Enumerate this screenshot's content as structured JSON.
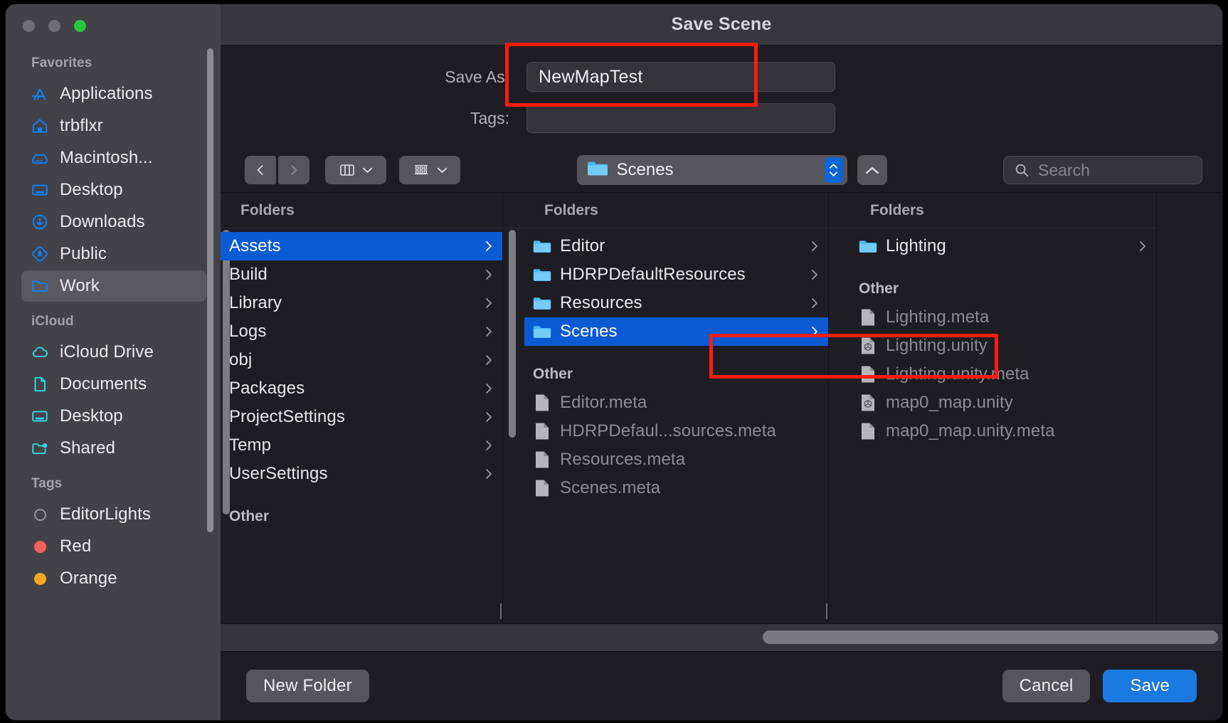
{
  "window": {
    "title": "Save Scene",
    "traffic_lights": [
      "close-button",
      "minimize-button",
      "zoom-button"
    ]
  },
  "colors": {
    "accent_blue": "#0a5ad4",
    "primary_button": "#1b7ae0",
    "annotation_red": "#ff1c0a",
    "sidebar_bg": "#434248",
    "panel_bg": "#1e1d24",
    "titlebar_bg": "#38373d"
  },
  "sidebar": {
    "sections": [
      {
        "title": "Favorites",
        "items": [
          {
            "label": "Applications",
            "icon": "applications-icon",
            "selected": false
          },
          {
            "label": "trbflxr",
            "icon": "home-icon",
            "selected": false
          },
          {
            "label": "Macintosh...",
            "icon": "harddisk-icon",
            "selected": false
          },
          {
            "label": "Desktop",
            "icon": "desktop-icon",
            "selected": false
          },
          {
            "label": "Downloads",
            "icon": "downloads-icon",
            "selected": false
          },
          {
            "label": "Public",
            "icon": "public-folder-icon",
            "selected": false
          },
          {
            "label": "Work",
            "icon": "folder-icon",
            "selected": true
          }
        ]
      },
      {
        "title": "iCloud",
        "items": [
          {
            "label": "iCloud Drive",
            "icon": "cloud-icon",
            "selected": false
          },
          {
            "label": "Documents",
            "icon": "document-icon",
            "selected": false
          },
          {
            "label": "Desktop",
            "icon": "desktop-icon",
            "selected": false
          },
          {
            "label": "Shared",
            "icon": "shared-folder-icon",
            "selected": false
          }
        ]
      },
      {
        "title": "Tags",
        "items": [
          {
            "label": "EditorLights",
            "icon": "tag-dot-hollow",
            "color": "",
            "selected": false
          },
          {
            "label": "Red",
            "icon": "tag-dot",
            "color": "#f4605c",
            "selected": false
          },
          {
            "label": "Orange",
            "icon": "tag-dot",
            "color": "#f5a623",
            "selected": false
          }
        ]
      }
    ]
  },
  "fields": {
    "save_as_label": "Save As:",
    "save_as_value": "NewMapTest",
    "tags_label": "Tags:",
    "tags_value": ""
  },
  "toolbar": {
    "back_icon": "chevron-left-icon",
    "forward_icon": "chevron-right-icon",
    "view_mode_icon": "column-view-icon",
    "group_by_icon": "group-items-icon",
    "path_label": "Scenes",
    "path_icon": "folder-icon",
    "stepper_icon": "up-down-stepper-icon",
    "up_icon": "chevron-up-icon",
    "search_placeholder": "Search",
    "search_icon": "search-icon",
    "search_value": ""
  },
  "browser": {
    "columns": [
      {
        "header": "Folders",
        "items": [
          {
            "label": "Assets",
            "type": "folder",
            "icon": "",
            "selected": true,
            "chevron": true,
            "disabled": false
          },
          {
            "label": "Build",
            "type": "folder",
            "icon": "",
            "selected": false,
            "chevron": true,
            "disabled": false
          },
          {
            "label": "Library",
            "type": "folder",
            "icon": "",
            "selected": false,
            "chevron": true,
            "disabled": false
          },
          {
            "label": "Logs",
            "type": "folder",
            "icon": "",
            "selected": false,
            "chevron": true,
            "disabled": false
          },
          {
            "label": "obj",
            "type": "folder",
            "icon": "",
            "selected": false,
            "chevron": true,
            "disabled": false
          },
          {
            "label": "Packages",
            "type": "folder",
            "icon": "",
            "selected": false,
            "chevron": true,
            "disabled": false
          },
          {
            "label": "ProjectSettings",
            "type": "folder",
            "icon": "",
            "selected": false,
            "chevron": true,
            "disabled": false
          },
          {
            "label": "Temp",
            "type": "folder",
            "icon": "",
            "selected": false,
            "chevron": true,
            "disabled": false
          },
          {
            "label": "UserSettings",
            "type": "folder",
            "icon": "",
            "selected": false,
            "chevron": true,
            "disabled": false
          }
        ],
        "sub_header": "Other",
        "sub_items": []
      },
      {
        "header": "Folders",
        "items": [
          {
            "label": "Editor",
            "type": "folder",
            "icon": "folder-icon",
            "selected": false,
            "chevron": true,
            "disabled": false
          },
          {
            "label": "HDRPDefaultResources",
            "type": "folder",
            "icon": "folder-icon",
            "selected": false,
            "chevron": true,
            "disabled": false
          },
          {
            "label": "Resources",
            "type": "folder",
            "icon": "folder-icon",
            "selected": false,
            "chevron": true,
            "disabled": false
          },
          {
            "label": "Scenes",
            "type": "folder",
            "icon": "folder-icon",
            "selected": true,
            "chevron": true,
            "disabled": false
          }
        ],
        "sub_header": "Other",
        "sub_items": [
          {
            "label": "Editor.meta",
            "type": "file",
            "icon": "file-icon",
            "disabled": true
          },
          {
            "label": "HDRPDefaul...sources.meta",
            "type": "file",
            "icon": "file-icon",
            "disabled": true
          },
          {
            "label": "Resources.meta",
            "type": "file",
            "icon": "file-icon",
            "disabled": true
          },
          {
            "label": "Scenes.meta",
            "type": "file",
            "icon": "file-icon",
            "disabled": true
          }
        ]
      },
      {
        "header": "Folders",
        "items": [
          {
            "label": "Lighting",
            "type": "folder",
            "icon": "folder-icon",
            "selected": false,
            "chevron": true,
            "disabled": false
          }
        ],
        "sub_header": "Other",
        "sub_items": [
          {
            "label": "Lighting.meta",
            "type": "file",
            "icon": "file-icon",
            "disabled": true
          },
          {
            "label": "Lighting.unity",
            "type": "file",
            "icon": "unity-file-icon",
            "disabled": true
          },
          {
            "label": "Lighting.unity.meta",
            "type": "file",
            "icon": "file-icon",
            "disabled": true
          },
          {
            "label": "map0_map.unity",
            "type": "file",
            "icon": "unity-file-icon",
            "disabled": true
          },
          {
            "label": "map0_map.unity.meta",
            "type": "file",
            "icon": "file-icon",
            "disabled": true
          }
        ]
      }
    ]
  },
  "footer": {
    "new_folder_label": "New Folder",
    "cancel_label": "Cancel",
    "save_label": "Save"
  },
  "annotations": [
    {
      "name": "save-as-field-highlight",
      "target": "save_as_field"
    },
    {
      "name": "scenes-row-highlight",
      "target": "scenes_row"
    }
  ]
}
